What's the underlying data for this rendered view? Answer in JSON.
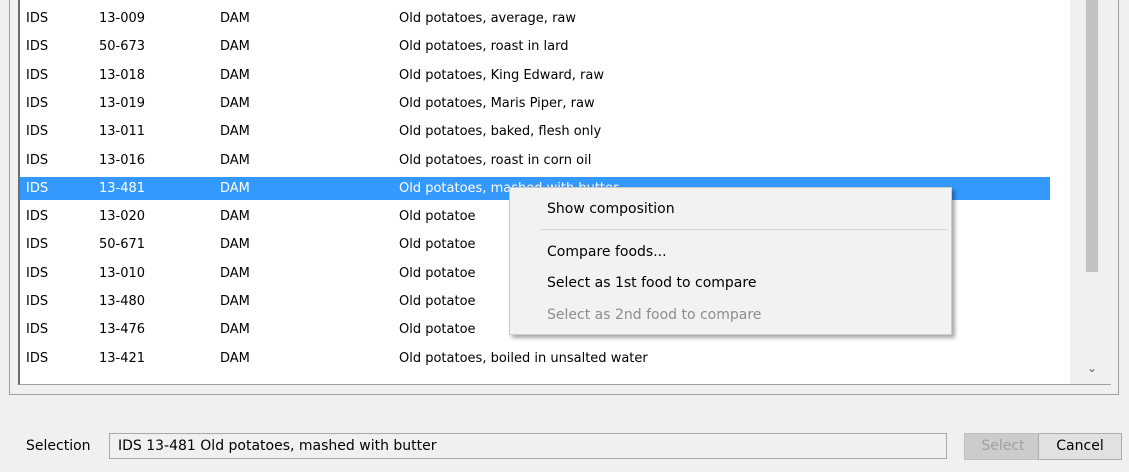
{
  "food_list": {
    "rows": [
      {
        "source": "IDS",
        "code": "13-009",
        "db": "DAM",
        "name": "Old potatoes, average, raw",
        "selected": false
      },
      {
        "source": "IDS",
        "code": "50-673",
        "db": "DAM",
        "name": "Old potatoes, roast in lard",
        "selected": false
      },
      {
        "source": "IDS",
        "code": "13-018",
        "db": "DAM",
        "name": "Old potatoes, King Edward, raw",
        "selected": false
      },
      {
        "source": "IDS",
        "code": "13-019",
        "db": "DAM",
        "name": "Old potatoes, Maris Piper, raw",
        "selected": false
      },
      {
        "source": "IDS",
        "code": "13-011",
        "db": "DAM",
        "name": "Old potatoes, baked, flesh only",
        "selected": false
      },
      {
        "source": "IDS",
        "code": "13-016",
        "db": "DAM",
        "name": "Old potatoes, roast in corn oil",
        "selected": false
      },
      {
        "source": "IDS",
        "code": "13-481",
        "db": "DAM",
        "name": "Old potatoes, mashed with butter",
        "selected": true
      },
      {
        "source": "IDS",
        "code": "13-020",
        "db": "DAM",
        "name": "Old potatoe",
        "selected": false
      },
      {
        "source": "IDS",
        "code": "50-671",
        "db": "DAM",
        "name": "Old potatoe",
        "selected": false
      },
      {
        "source": "IDS",
        "code": "13-010",
        "db": "DAM",
        "name": "Old potatoe",
        "selected": false
      },
      {
        "source": "IDS",
        "code": "13-480",
        "db": "DAM",
        "name": "Old potatoe",
        "selected": false
      },
      {
        "source": "IDS",
        "code": "13-476",
        "db": "DAM",
        "name": "Old potatoe",
        "selected": false
      },
      {
        "source": "IDS",
        "code": "13-421",
        "db": "DAM",
        "name": "Old potatoes, boiled in unsalted water",
        "selected": false
      }
    ],
    "selected_color": "#3399ff"
  },
  "context_menu": {
    "items": [
      {
        "label": "Show composition",
        "enabled": true
      },
      {
        "label": "Compare foods...",
        "enabled": true
      },
      {
        "label": "Select as 1st food to compare",
        "enabled": true
      },
      {
        "label": "Select as 2nd food to compare",
        "enabled": false
      }
    ]
  },
  "scrollbar": {
    "down_icon": "chevron-down-icon",
    "glyph": "⌄"
  },
  "footer": {
    "selection_label": "Selection",
    "selection_value": "IDS  13-481  Old potatoes, mashed with butter",
    "select_label": "Select",
    "cancel_label": "Cancel"
  }
}
